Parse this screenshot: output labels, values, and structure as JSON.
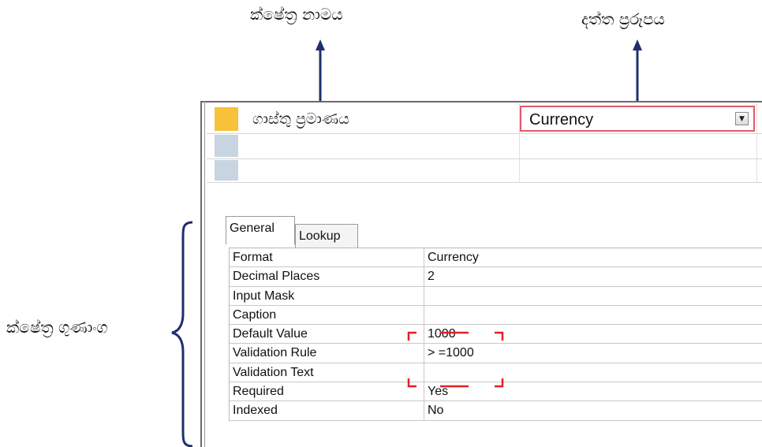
{
  "annotations": {
    "field_name": "ක්ෂේත්‍ර නාමය",
    "data_type": "දත්ත ප්‍රරූපය",
    "field_properties": "ක්ෂේත්‍ර ගුණාංග"
  },
  "table_design": {
    "rows": [
      {
        "field_name": "ගාස්තු ප්‍රමාණය",
        "data_type": "Currency",
        "selected": true
      },
      {
        "field_name": "",
        "data_type": ""
      },
      {
        "field_name": "",
        "data_type": ""
      }
    ]
  },
  "tabs": [
    {
      "label": "General",
      "active": true
    },
    {
      "label": "Lookup",
      "active": false
    }
  ],
  "properties": [
    {
      "name": "Format",
      "value": "Currency"
    },
    {
      "name": "Decimal Places",
      "value": "2"
    },
    {
      "name": "Input Mask",
      "value": ""
    },
    {
      "name": "Caption",
      "value": ""
    },
    {
      "name": "Default Value",
      "value": "1000"
    },
    {
      "name": "Validation Rule",
      "value": "> =1000"
    },
    {
      "name": "Validation Text",
      "value": ""
    },
    {
      "name": "Required",
      "value": "Yes"
    },
    {
      "name": "Indexed",
      "value": "No"
    }
  ],
  "colors": {
    "arrow": "#1f2f6e",
    "row_selector_active": "#f7c23a",
    "row_selector": "#c8d4e0",
    "highlight": "#e0202a"
  },
  "icons": {
    "dropdown": "chevron-down-icon"
  }
}
